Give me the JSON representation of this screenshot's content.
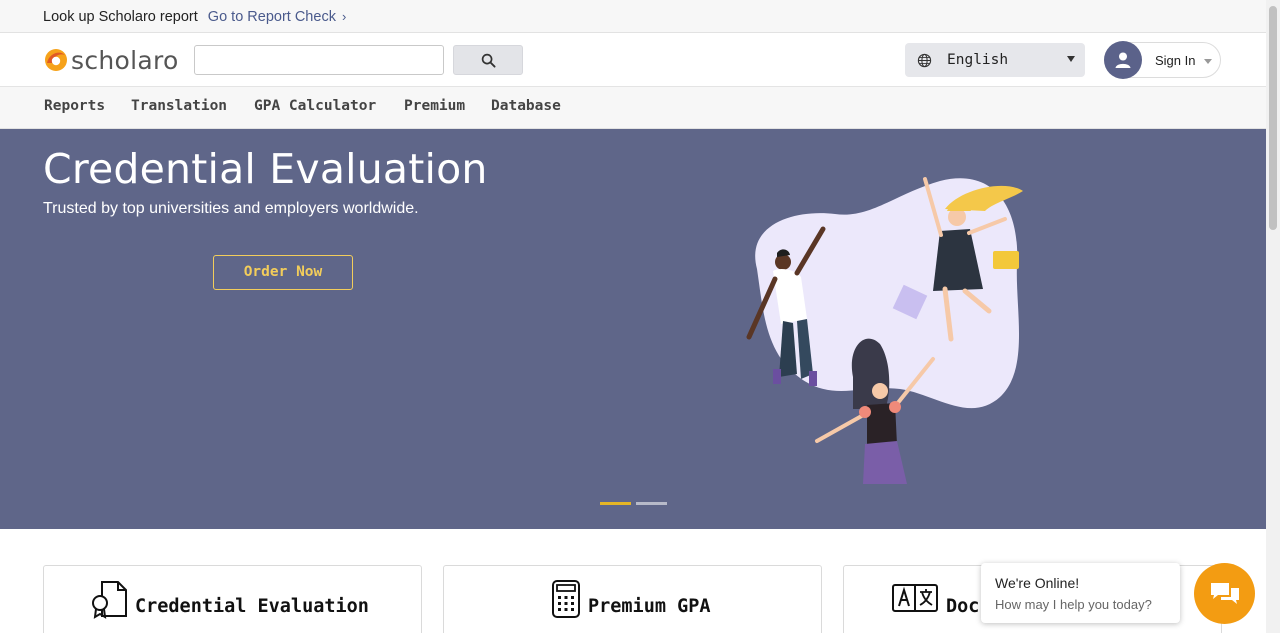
{
  "topbar": {
    "lookup_text": "Look up Scholaro report",
    "report_link": "Go to Report Check",
    "chevron_glyph": "›"
  },
  "header": {
    "logo_text": "scholaro",
    "search": {
      "value": "",
      "placeholder": ""
    },
    "search_icon": "search-icon",
    "language": {
      "selected": "English",
      "icon": "globe-icon"
    },
    "signin_label": "Sign In"
  },
  "nav": {
    "items": [
      {
        "label": "Reports"
      },
      {
        "label": "Translation"
      },
      {
        "label": "GPA Calculator"
      },
      {
        "label": "Premium"
      },
      {
        "label": "Database"
      }
    ]
  },
  "hero": {
    "title": "Credential Evaluation",
    "subtitle": "Trusted by top universities and employers worldwide.",
    "cta_label": "Order Now",
    "carousel": {
      "slides": 2,
      "active": 1
    }
  },
  "cards": [
    {
      "title": "Credential Evaluation",
      "icon": "certificate-document-icon"
    },
    {
      "title": "Premium GPA",
      "icon": "calculator-icon"
    },
    {
      "title": "Doc",
      "icon": "translate-icon"
    }
  ],
  "chat": {
    "title": "We're Online!",
    "subtitle": "How may I help you today?",
    "icon": "chat-icon"
  },
  "colors": {
    "hero_bg": "#5f6689",
    "accent_yellow": "#f2cd5b",
    "link": "#4a5a8c",
    "chat_orange": "#f39c12",
    "carousel_active": "#e5b525",
    "carousel_inactive": "#b7bac9"
  }
}
